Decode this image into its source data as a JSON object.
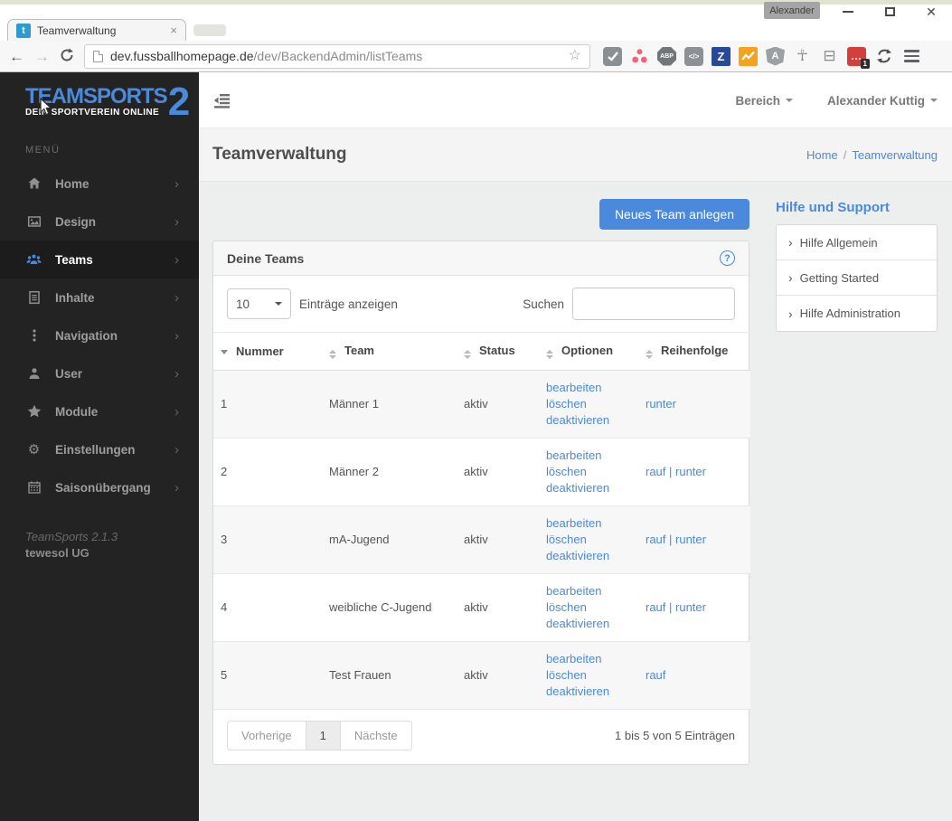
{
  "browser": {
    "profile_label": "Alexander",
    "tab_title": "Teamverwaltung",
    "favicon_letter": "t",
    "url_host": "dev.fussballhomepage.de",
    "url_path": "/dev/BackendAdmin/listTeams",
    "extensions": [
      {
        "name": "pulse-check-extension",
        "glyph": ""
      },
      {
        "name": "dots-triangle-extension",
        "glyph": ""
      },
      {
        "name": "adblock-plus-extension",
        "glyph": "ABP"
      },
      {
        "name": "code-extension",
        "glyph": "</>"
      },
      {
        "name": "z-extension",
        "glyph": "Z"
      },
      {
        "name": "analytics-extension",
        "glyph": ""
      },
      {
        "name": "angular-extension",
        "glyph": "A"
      },
      {
        "name": "ankh-extension",
        "glyph": "☥"
      },
      {
        "name": "window-extension",
        "glyph": "⊟"
      },
      {
        "name": "red-dots-extension",
        "glyph": "…",
        "badge": "1"
      },
      {
        "name": "sync-extension",
        "glyph": ""
      }
    ]
  },
  "sidebar": {
    "logo_title": "TEAMSPORTS",
    "logo_number": "2",
    "logo_subtitle": "DEIN SPORTVEREIN ONLINE",
    "menu_label": "MENÜ",
    "items": [
      {
        "label": "Home",
        "icon": "home-icon"
      },
      {
        "label": "Design",
        "icon": "image-icon"
      },
      {
        "label": "Teams",
        "icon": "users-icon",
        "active": true
      },
      {
        "label": "Inhalte",
        "icon": "document-icon"
      },
      {
        "label": "Navigation",
        "icon": "ellipsis-icon"
      },
      {
        "label": "User",
        "icon": "user-icon"
      },
      {
        "label": "Module",
        "icon": "star-icon"
      },
      {
        "label": "Einstellungen",
        "icon": "gears-icon"
      },
      {
        "label": "Saisonübergang",
        "icon": "calendar-icon"
      }
    ],
    "version": "TeamSports 2.1.3",
    "company": "tewesol UG"
  },
  "topbar": {
    "area_menu": "Bereich",
    "user_menu": "Alexander Kuttig"
  },
  "page": {
    "title": "Teamverwaltung",
    "breadcrumb_home": "Home",
    "breadcrumb_sep": "/",
    "breadcrumb_current": "Teamverwaltung"
  },
  "content": {
    "new_team_button": "Neues Team anlegen",
    "panel_title": "Deine Teams",
    "help_icon": "?",
    "entries_value": "10",
    "entries_label": "Einträge anzeigen",
    "search_label": "Suchen",
    "table": {
      "columns": [
        "Nummer",
        "Team",
        "Status",
        "Optionen",
        "Reihenfolge"
      ],
      "rows": [
        {
          "nummer": "1",
          "team": "Männer 1",
          "status": "aktiv",
          "optionen": [
            "bearbeiten",
            "löschen",
            "deaktivieren"
          ],
          "reihenfolge": [
            "runter"
          ]
        },
        {
          "nummer": "2",
          "team": "Männer 2",
          "status": "aktiv",
          "optionen": [
            "bearbeiten",
            "löschen",
            "deaktivieren"
          ],
          "reihenfolge": [
            "rauf",
            "runter"
          ]
        },
        {
          "nummer": "3",
          "team": "mA-Jugend",
          "status": "aktiv",
          "optionen": [
            "bearbeiten",
            "löschen",
            "deaktivieren"
          ],
          "reihenfolge": [
            "rauf",
            "runter"
          ]
        },
        {
          "nummer": "4",
          "team": "weibliche C-Jugend",
          "status": "aktiv",
          "optionen": [
            "bearbeiten",
            "löschen",
            "deaktivieren"
          ],
          "reihenfolge": [
            "rauf",
            "runter"
          ]
        },
        {
          "nummer": "5",
          "team": "Test Frauen",
          "status": "aktiv",
          "optionen": [
            "bearbeiten",
            "löschen",
            "deaktivieren"
          ],
          "reihenfolge": [
            "rauf"
          ]
        }
      ]
    },
    "pagination": {
      "previous": "Vorherige",
      "page": "1",
      "next": "Nächste",
      "info": "1 bis 5 von 5 Einträgen"
    }
  },
  "help": {
    "title": "Hilfe und Support",
    "items": [
      "Hilfe Allgemein",
      "Getting Started",
      "Hilfe Administration"
    ]
  }
}
